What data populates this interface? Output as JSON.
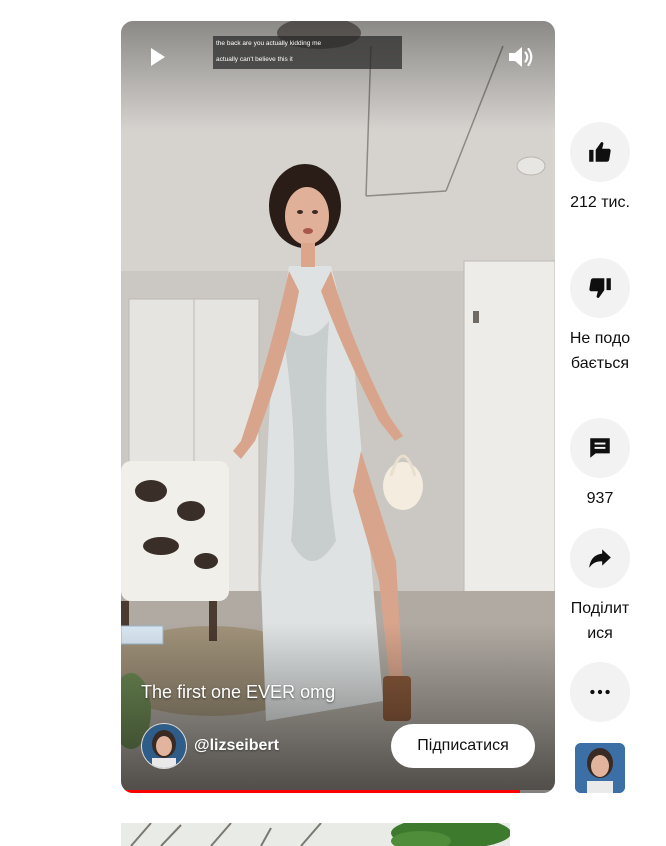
{
  "player": {
    "caption_lines": [
      "the back are you actually kidding me",
      "actually can't believe this it"
    ],
    "title": "The first one EVER omg",
    "channel_handle": "@lizseibert",
    "subscribe_label": "Підписатися",
    "progress_fraction": 0.92,
    "icons": {
      "play": "play-icon",
      "volume": "volume-icon"
    }
  },
  "actions": {
    "like": {
      "label": "212 тис.",
      "icon": "thumbs-up-icon"
    },
    "dislike": {
      "label": "Не подобається",
      "icon": "thumbs-down-icon"
    },
    "comments": {
      "label": "937",
      "icon": "comment-icon"
    },
    "share": {
      "label": "Поділитися",
      "icon": "share-icon"
    },
    "more": {
      "icon": "more-icon"
    }
  },
  "colors": {
    "accent_progress": "#ff0000",
    "action_button_bg": "#f2f2f2",
    "text": "#0f0f0f"
  }
}
